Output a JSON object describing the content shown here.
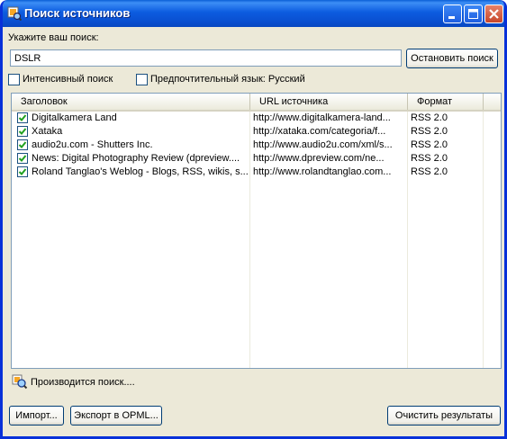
{
  "window": {
    "title": "Поиск источников"
  },
  "search": {
    "prompt": "Укажите ваш поиск:",
    "value": "DSLR",
    "stop_button": "Остановить поиск",
    "intensive_label": "Интенсивный поиск",
    "intensive_checked": false,
    "language_label": "Предпочтительный язык: Русский",
    "language_checked": false
  },
  "table": {
    "columns": [
      "Заголовок",
      "URL источника",
      "Формат"
    ],
    "rows": [
      {
        "checked": true,
        "title": "Digitalkamera Land",
        "url": "http://www.digitalkamera-land...",
        "format": "RSS 2.0"
      },
      {
        "checked": true,
        "title": "Xataka",
        "url": "http://xataka.com/categoria/f...",
        "format": "RSS 2.0"
      },
      {
        "checked": true,
        "title": "audio2u.com - Shutters Inc.",
        "url": "http://www.audio2u.com/xml/s...",
        "format": "RSS 2.0"
      },
      {
        "checked": true,
        "title": "News: Digital Photography Review (dpreview....",
        "url": "http://www.dpreview.com/ne...",
        "format": "RSS 2.0"
      },
      {
        "checked": true,
        "title": "Roland Tanglao's Weblog - Blogs, RSS, wikis, s...",
        "url": "http://www.rolandtanglao.com...",
        "format": "RSS 2.0"
      }
    ]
  },
  "status": {
    "text": "Производится поиск....",
    "icon": "search-progress-icon"
  },
  "footer": {
    "import_button": "Импорт...",
    "export_button": "Экспорт в OPML...",
    "clear_button": "Очистить результаты"
  },
  "colors": {
    "titlebar": "#0a5fd6",
    "frame": "#ece9d8",
    "check": "#21a121"
  }
}
